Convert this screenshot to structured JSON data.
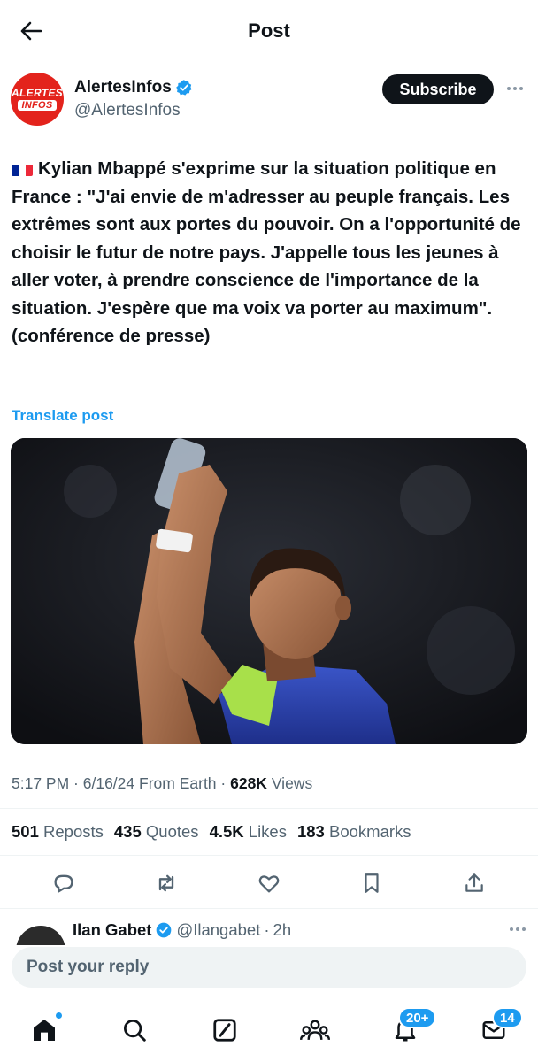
{
  "header": {
    "title": "Post",
    "back_icon": "arrow-left-icon"
  },
  "author": {
    "avatar_text_line1": "ALERTES",
    "avatar_text_line2": "INFOS",
    "display_name": "AlertesInfos",
    "handle": "@AlertesInfos",
    "verified": true,
    "subscribe_label": "Subscribe"
  },
  "post": {
    "flag": "France flag",
    "text": "Kylian Mbappé s'exprime sur la situation politique en France : \"J'ai envie de m'adresser au peuple français. Les extrêmes sont aux portes du pouvoir. On a l'opportunité de choisir le futur de notre pays. J'appelle tous les jeunes à aller voter, à prendre conscience de l'importance de la situation. J'espère que ma voix va porter au maximum\". (conférence de presse)",
    "translate_label": "Translate post"
  },
  "meta": {
    "time": "5:17 PM",
    "date": "6/16/24",
    "source": "From Earth",
    "views_count": "628K",
    "views_label": "Views"
  },
  "stats": {
    "reposts_count": "501",
    "reposts_label": "Reposts",
    "quotes_count": "435",
    "quotes_label": "Quotes",
    "likes_count": "4.5K",
    "likes_label": "Likes",
    "bookmarks_count": "183",
    "bookmarks_label": "Bookmarks"
  },
  "reply_preview": {
    "name": "Ilan Gabet",
    "handle": "@Ilangabet",
    "time": "2h",
    "verified": true
  },
  "reply_input": {
    "placeholder": "Post your reply"
  },
  "tabbar": {
    "notifications_badge": "20+",
    "messages_badge": "14"
  },
  "colors": {
    "accent": "#1d9bf0",
    "text": "#0f1419",
    "muted": "#536471",
    "avatar_red": "#e3231c"
  }
}
